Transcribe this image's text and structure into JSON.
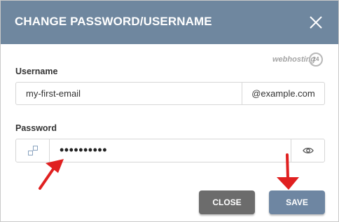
{
  "dialog": {
    "title": "CHANGE PASSWORD/USERNAME",
    "brand": {
      "word": "webhosting",
      "badge": "24"
    }
  },
  "username": {
    "label": "Username",
    "value": "my-first-email",
    "suffix": "@example.com"
  },
  "password": {
    "label": "Password",
    "masked_value": "••••••••••"
  },
  "buttons": {
    "close_label": "CLOSE",
    "save_label": "SAVE"
  },
  "icons": {
    "close": "close-x-icon",
    "generate": "key-generate-icon",
    "reveal": "eye-icon",
    "annotation": "red-arrow-icon"
  },
  "colors": {
    "header": "#6f879f",
    "save_button": "#6e86a2",
    "close_button": "#6c6c6c",
    "annotation": "#e02020"
  }
}
